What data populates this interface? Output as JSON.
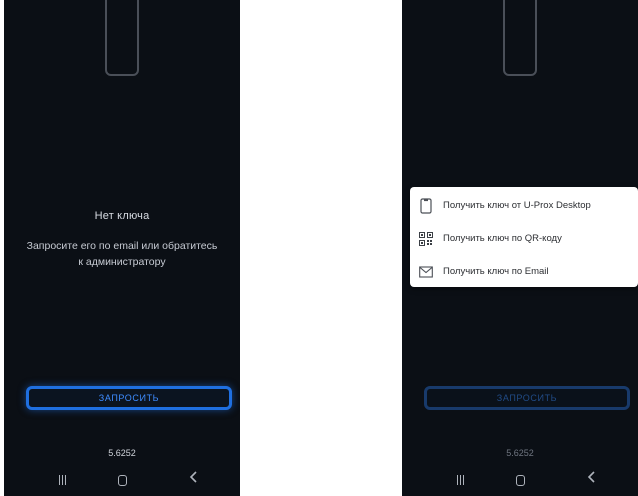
{
  "top_caption": "",
  "left_screen": {
    "empty_title": "Нет ключа",
    "empty_desc": "Запросите его по email или обратитесь к администратору",
    "request_button": "ЗАПРОСИТЬ",
    "version": "5.6252",
    "nav": {
      "recents_icon": "recents-icon",
      "home_icon": "home-icon",
      "back_icon": "back-icon"
    }
  },
  "right_screen": {
    "request_button": "ЗАПРОСИТЬ",
    "version": "5.6252",
    "menu": [
      {
        "label": "Получить ключ от U-Prox Desktop",
        "icon": "phone-icon"
      },
      {
        "label": "Получить ключ по QR-коду",
        "icon": "qr-code-icon"
      },
      {
        "label": "Получить ключ по Email",
        "icon": "mail-icon"
      }
    ]
  },
  "colors": {
    "screen_bg": "#0b0f15",
    "accent": "#1f6fe0",
    "menu_bg": "#ffffff",
    "text_light": "#d7dbe2"
  }
}
